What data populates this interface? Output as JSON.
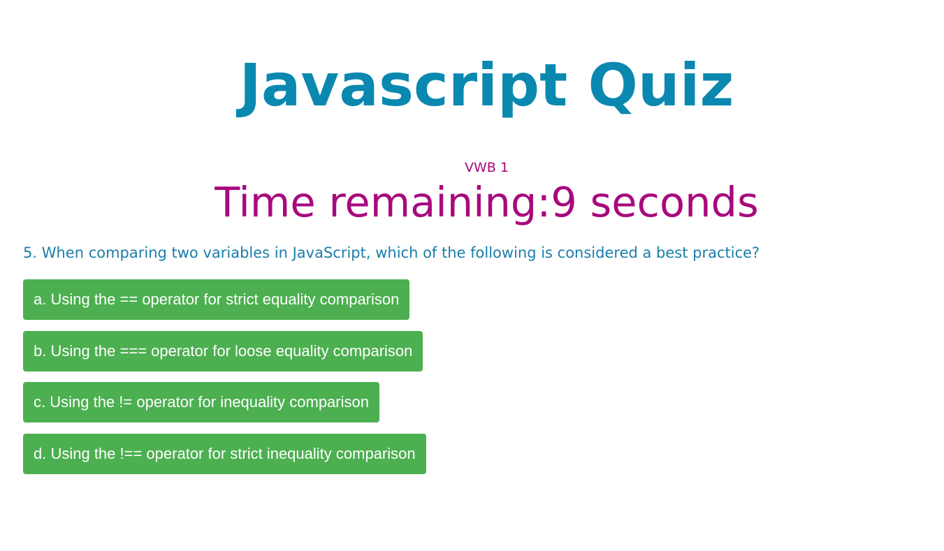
{
  "header": {
    "title": "Javascript Quiz"
  },
  "quiz": {
    "group_label": "VWB 1",
    "timer_text": "Time remaining:9 seconds",
    "question": "5. When comparing two variables in JavaScript, which of the following is considered a best practice?",
    "answers": [
      "a. Using the == operator for strict equality comparison",
      "b. Using the === operator for loose equality comparison",
      "c. Using the != operator for inequality comparison",
      "d. Using the !== operator for strict inequality comparison"
    ]
  },
  "colors": {
    "title": "#0A88B0",
    "timer": "#A8097D",
    "question": "#1A7DA8",
    "answer_button": "#4CAF50",
    "answer_text": "#FFFFFF"
  }
}
